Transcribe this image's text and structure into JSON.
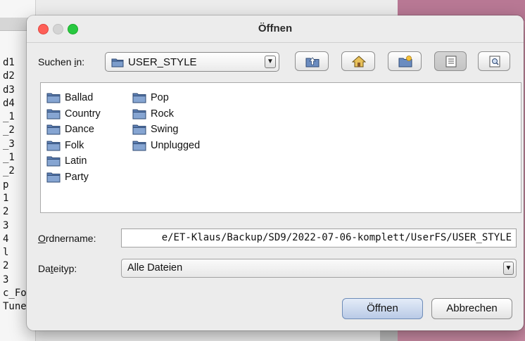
{
  "background": {
    "list_items": [
      "d1",
      "d2",
      "d3",
      "d4",
      "_1",
      "_2",
      "_3",
      "_1",
      "_2",
      "p",
      "1",
      "2",
      "3",
      "4",
      "l",
      "2",
      "3",
      "c_Fo",
      "Tune"
    ]
  },
  "dialog": {
    "title": "Öffnen",
    "search_in": {
      "label_prefix": "Suchen ",
      "label_mnemonic": "i",
      "label_suffix": "n:",
      "value": "USER_STYLE"
    },
    "toolbar": {
      "icons": [
        "up-folder-icon",
        "home-icon",
        "new-folder-icon",
        "list-view-icon",
        "details-view-icon"
      ]
    },
    "folders_col1": [
      "Ballad",
      "Country",
      "Dance",
      "Folk",
      "Latin",
      "Party"
    ],
    "folders_col2": [
      "Pop",
      "Rock",
      "Swing",
      "Unplugged"
    ],
    "folder_name": {
      "label_mnemonic": "O",
      "label_rest": "rdnername:",
      "value": "e/ET-Klaus/Backup/SD9/2022-07-06-komplett/UserFS/USER_STYLE"
    },
    "file_type": {
      "label_prefix": "Da",
      "label_mnemonic": "t",
      "label_suffix": "eityp:",
      "value": "Alle Dateien"
    },
    "open_button": "Öffnen",
    "cancel_button": "Abbrechen"
  },
  "colors": {
    "close": "#fe5f57",
    "minimize": "#d4d4d4",
    "zoom": "#28c840",
    "folder": "#4a6fa5",
    "background_pink": "#c98aa3"
  }
}
